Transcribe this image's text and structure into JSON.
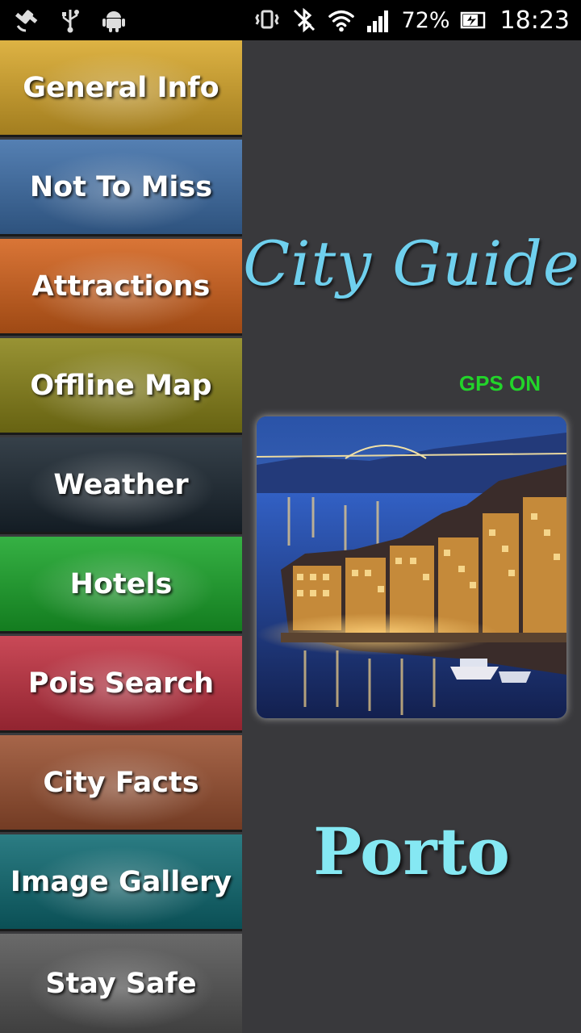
{
  "status_bar": {
    "icons_left": [
      "satellite-icon",
      "usb-icon",
      "android-icon"
    ],
    "icons_right": [
      "vibrate-icon",
      "bluetooth-off-icon",
      "wifi-icon",
      "signal-icon"
    ],
    "battery": "72%",
    "time": "18:23"
  },
  "menu": {
    "items": [
      {
        "label": "General Info",
        "color": "#d9a82a"
      },
      {
        "label": "Not To Miss",
        "color": "#3d6ea8"
      },
      {
        "label": "Attractions",
        "color": "#d4621b"
      },
      {
        "label": "Offline Map",
        "color": "#8a8418"
      },
      {
        "label": "Weather",
        "color": "#1a2630"
      },
      {
        "label": "Hotels",
        "color": "#1aa62a"
      },
      {
        "label": "Pois Search",
        "color": "#c23040"
      },
      {
        "label": "City Facts",
        "color": "#9a5030"
      },
      {
        "label": "Image Gallery",
        "color": "#0e6a72"
      },
      {
        "label": "Stay Safe",
        "color": "#555555"
      }
    ]
  },
  "main": {
    "title": "City Guide",
    "gps_status": "GPS ON",
    "city": "Porto",
    "photo_icon": "city-photo"
  },
  "colors": {
    "title": "#6fd0ee",
    "gps": "#22d42a",
    "city": "#85e8f3",
    "panel": "#39393c"
  }
}
